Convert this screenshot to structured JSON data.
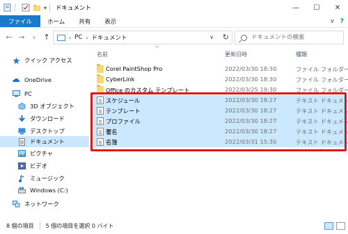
{
  "window": {
    "title": "ドキュメント",
    "minimize": "—",
    "maximize": "☐",
    "close": "✕"
  },
  "ribbon": {
    "tabs": [
      "ファイル",
      "ホーム",
      "共有",
      "表示"
    ],
    "collapse_glyph": "∨",
    "help_glyph": "?"
  },
  "address": {
    "back": "←",
    "forward": "→",
    "recent": "∨",
    "up": "↑",
    "crumbs": [
      "PC",
      "ドキュメント"
    ],
    "separator": "›",
    "dropdown": "∨",
    "refresh": "↻",
    "search_placeholder": "ドキュメントの検索"
  },
  "nav": {
    "items": [
      {
        "label": "クイック アクセス",
        "icon": "star-icon"
      },
      {
        "label": "OneDrive",
        "icon": "cloud-icon"
      },
      {
        "label": "PC",
        "icon": "computer-icon"
      },
      {
        "label": "3D オブジェクト",
        "icon": "cube-icon"
      },
      {
        "label": "ダウンロード",
        "icon": "download-icon"
      },
      {
        "label": "デスクトップ",
        "icon": "desktop-icon"
      },
      {
        "label": "ドキュメント",
        "icon": "documents-icon"
      },
      {
        "label": "ピクチャ",
        "icon": "pictures-icon"
      },
      {
        "label": "ビデオ",
        "icon": "video-icon"
      },
      {
        "label": "ミュージック",
        "icon": "music-icon"
      },
      {
        "label": "Windows (C:)",
        "icon": "drive-icon"
      },
      {
        "label": "ネットワーク",
        "icon": "network-icon"
      }
    ]
  },
  "columns": {
    "name": "名前",
    "date": "更新日時",
    "type": "種類",
    "sort_glyph": "^"
  },
  "files": [
    {
      "name": "Corel PaintShop Pro",
      "date": "2022/03/30 18:30",
      "type": "ファイル フォルダー",
      "kind": "folder"
    },
    {
      "name": "CyberLink",
      "date": "2022/03/30 18:30",
      "type": "ファイル フォルダー",
      "kind": "folder"
    },
    {
      "name": "Office のカスタム テンプレート",
      "date": "2022/03/25 19:30",
      "type": "ファイル フォルダー",
      "kind": "folder"
    },
    {
      "name": "スケジュール",
      "date": "2022/03/30 18:27",
      "type": "テキスト ドキュメント",
      "kind": "text"
    },
    {
      "name": "テンプレート",
      "date": "2022/03/30 18:27",
      "type": "テキスト ドキュメント",
      "kind": "text"
    },
    {
      "name": "プロファイル",
      "date": "2022/03/30 18:27",
      "type": "テキスト ドキュメント",
      "kind": "text"
    },
    {
      "name": "署名",
      "date": "2022/03/30 18:27",
      "type": "テキスト ドキュメント",
      "kind": "text"
    },
    {
      "name": "名簿",
      "date": "2022/03/31 15:30",
      "type": "テキスト ドキュメント",
      "kind": "text"
    }
  ],
  "status": {
    "item_count": "8 個の項目",
    "selection": "5 個の項目を選択  0 バイト"
  },
  "colors": {
    "accent": "#1979ca",
    "selection": "#cce8ff",
    "highlight_border": "#e01717",
    "folder": "#f8d775"
  }
}
